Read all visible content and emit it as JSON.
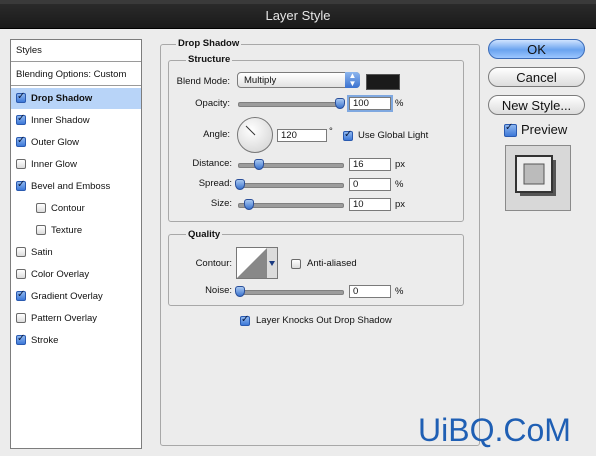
{
  "window": {
    "title": "Layer Style"
  },
  "styles_panel": {
    "header": "Styles",
    "blending": "Blending Options: Custom",
    "items": [
      {
        "label": "Drop Shadow",
        "checked": true,
        "selected": true
      },
      {
        "label": "Inner Shadow",
        "checked": true
      },
      {
        "label": "Outer Glow",
        "checked": true
      },
      {
        "label": "Inner Glow",
        "checked": false
      },
      {
        "label": "Bevel and Emboss",
        "checked": true
      },
      {
        "label": "Contour",
        "checked": false
      },
      {
        "label": "Texture",
        "checked": false
      },
      {
        "label": "Satin",
        "checked": false
      },
      {
        "label": "Color Overlay",
        "checked": false
      },
      {
        "label": "Gradient Overlay",
        "checked": true
      },
      {
        "label": "Pattern Overlay",
        "checked": false
      },
      {
        "label": "Stroke",
        "checked": true
      }
    ]
  },
  "drop_shadow": {
    "section_title": "Drop Shadow",
    "structure": {
      "title": "Structure",
      "blend_mode_label": "Blend Mode:",
      "blend_mode_value": "Multiply",
      "shadow_color": "#1a1a1a",
      "opacity_label": "Opacity:",
      "opacity_value": "100",
      "opacity_unit": "%",
      "angle_label": "Angle:",
      "angle_value": "120",
      "angle_unit": "°",
      "use_global_light_label": "Use Global Light",
      "use_global_light": true,
      "distance_label": "Distance:",
      "distance_value": "16",
      "distance_unit": "px",
      "spread_label": "Spread:",
      "spread_value": "0",
      "spread_unit": "%",
      "size_label": "Size:",
      "size_value": "10",
      "size_unit": "px"
    },
    "quality": {
      "title": "Quality",
      "contour_label": "Contour:",
      "anti_aliased_label": "Anti-aliased",
      "anti_aliased": false,
      "noise_label": "Noise:",
      "noise_value": "0",
      "noise_unit": "%"
    },
    "layer_knocks_out_label": "Layer Knocks Out Drop Shadow",
    "layer_knocks_out": true
  },
  "buttons": {
    "ok": "OK",
    "cancel": "Cancel",
    "new_style": "New Style...",
    "preview_label": "Preview",
    "preview_checked": true
  },
  "watermark": {
    "text": "UiBQ.CoM"
  }
}
